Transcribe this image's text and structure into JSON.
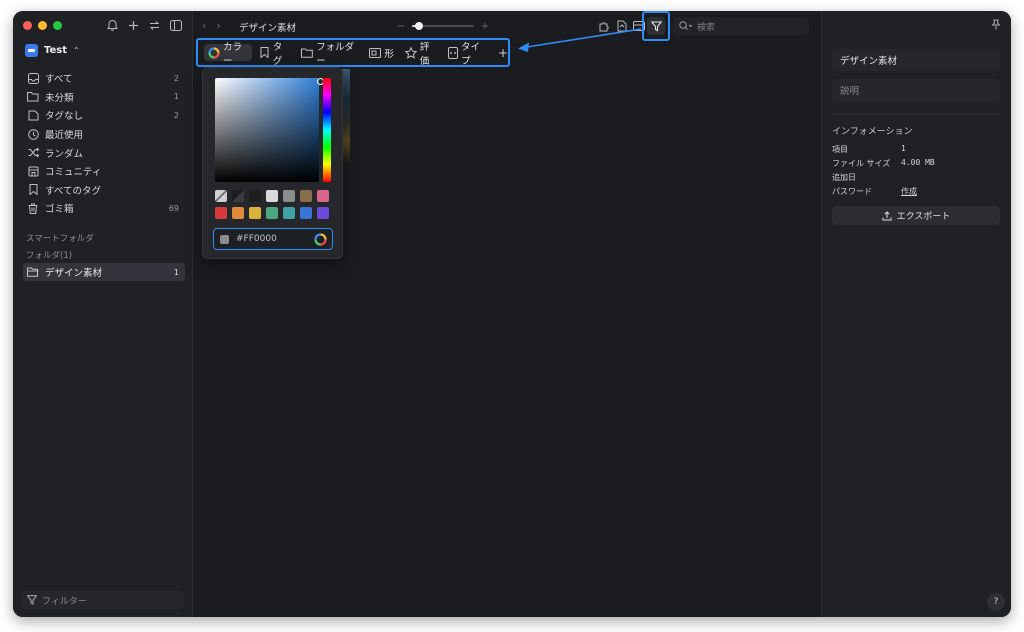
{
  "sidebar": {
    "library_name": "Test",
    "items": [
      {
        "label": "すべて",
        "count": "2"
      },
      {
        "label": "未分類",
        "count": "1"
      },
      {
        "label": "タグなし",
        "count": "2"
      },
      {
        "label": "最近使用",
        "count": ""
      },
      {
        "label": "ランダム",
        "count": ""
      },
      {
        "label": "コミュニティ",
        "count": ""
      },
      {
        "label": "すべてのタグ",
        "count": ""
      },
      {
        "label": "ゴミ箱",
        "count": "69"
      }
    ],
    "smart_folder_title": "スマートフォルダ",
    "folder_title": "フォルダ(1)",
    "folder": {
      "label": "デザイン素材",
      "count": "1"
    },
    "filter_placeholder": "フィルター"
  },
  "toolbar": {
    "breadcrumb": "デザイン素材",
    "zoom_level": 0.12,
    "search_placeholder": "検索"
  },
  "filterbar": {
    "chips": [
      {
        "label": "カラー",
        "icon": "color-wheel-icon"
      },
      {
        "label": "タグ",
        "icon": "bookmark-icon"
      },
      {
        "label": "フォルダー",
        "icon": "folder-icon"
      },
      {
        "label": "形",
        "icon": "shape-icon"
      },
      {
        "label": "評価",
        "icon": "star-icon"
      },
      {
        "label": "タイプ",
        "icon": "file-type-icon"
      }
    ],
    "add_label": "+"
  },
  "color_picker": {
    "hex_value": "#FF0000",
    "swatches": [
      "none",
      "#3a3b3f",
      "#1e1e1e",
      "#d9d9d9",
      "#8c8c8c",
      "#8a6d4a",
      "#d9648c",
      "#d63a3a",
      "#e08a3c",
      "#d9b33a",
      "#4aa880",
      "#3fa3a8",
      "#3a74d6",
      "#6a4ad6"
    ],
    "accent": "#2f8cf5"
  },
  "details": {
    "name": "デザイン素材",
    "description_placeholder": "説明",
    "info_title": "インフォメーション",
    "rows": [
      {
        "key": "項目",
        "value": "1"
      },
      {
        "key": "ファイル サイズ",
        "value": "4.00 MB"
      },
      {
        "key": "追加日",
        "value": ""
      },
      {
        "key": "パスワード",
        "value": "作成"
      }
    ],
    "export_label": "エクスポート",
    "help_label": "?"
  }
}
